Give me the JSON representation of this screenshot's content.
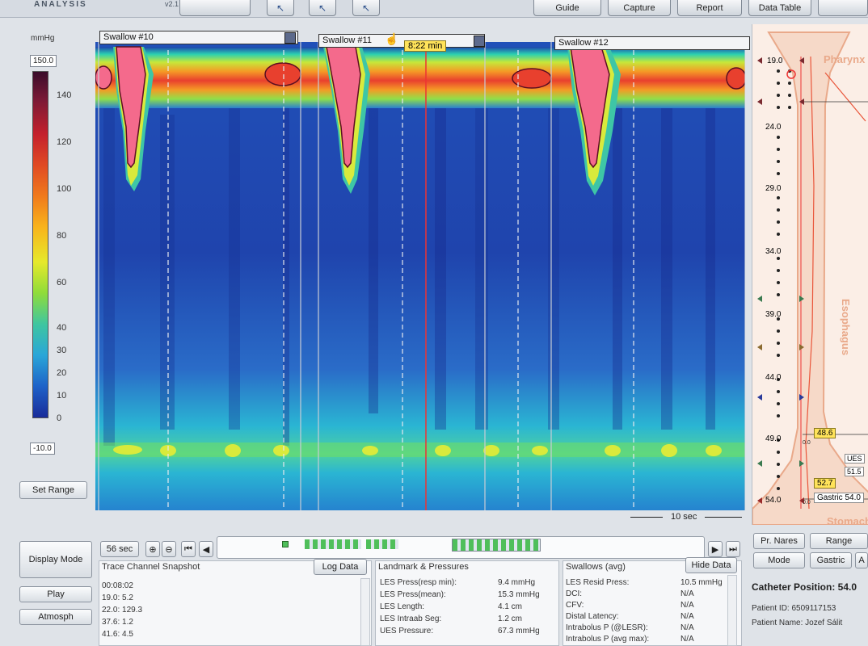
{
  "app": {
    "brand": "ANALYSIS",
    "brand_sub": "v2.1"
  },
  "toolbar": {
    "buttons": [
      {
        "label": "Guide"
      },
      {
        "label": "Capture"
      },
      {
        "label": "Report"
      },
      {
        "label": "Data Table"
      }
    ],
    "icons": [
      "arrow-back-icon",
      "zoom-region-icon",
      "cursor-arrow-icon"
    ]
  },
  "legend": {
    "unit": "mmHg",
    "max_value": "150.0",
    "min_value": "-10.0",
    "ticks": [
      "140",
      "120",
      "100",
      "80",
      "60",
      "40",
      "30",
      "20",
      "10",
      "0"
    ],
    "set_range_label": "Set Range"
  },
  "plot": {
    "swallows": [
      {
        "label": "Swallow #10"
      },
      {
        "label": "Swallow #11"
      },
      {
        "label": "Swallow #12"
      }
    ],
    "time_badge": "8:22 min",
    "scale_label": "10 sec",
    "palette": {
      "bg": "#1d3da3",
      "band": "#2ab7cf",
      "hot": "#f04a3a",
      "peak": "#f46a8c",
      "core": "#7a1230"
    }
  },
  "catheter": {
    "depths": [
      "19.0",
      "24.0",
      "29.0",
      "34.0",
      "39.0",
      "44.0",
      "49.0",
      "54.0"
    ],
    "regions": {
      "top": "Pharynx",
      "middle": "Esophagus",
      "bottom": "Stomach"
    },
    "badges": [
      "48.6",
      "52.7"
    ],
    "side_badges": [
      "UES",
      "51.5"
    ],
    "gastric_badge": "Gastric 54.0",
    "zero_labels": [
      "0.0",
      "0.0"
    ]
  },
  "navigation": {
    "duration_label": "56 sec"
  },
  "side_buttons": {
    "display_mode": "Display Mode",
    "play": "Play",
    "atmosph": "Atmosph"
  },
  "trace_snapshot": {
    "title": "Trace Channel Snapshot",
    "log_button": "Log Data",
    "rows": [
      "00:08:02",
      "19.0: 5.2",
      "22.0: 129.3",
      "37.6: 1.2",
      "41.6: 4.5"
    ]
  },
  "landmarks": {
    "title": "Landmark & Pressures",
    "rows": [
      {
        "label": "LES Press(resp min):",
        "value": "9.4 mmHg"
      },
      {
        "label": "LES Press(mean):",
        "value": "15.3 mmHg"
      },
      {
        "label": "LES Length:",
        "value": "4.1 cm"
      },
      {
        "label": "LES Intraab Seg:",
        "value": "1.2 cm"
      },
      {
        "label": "UES Pressure:",
        "value": "67.3 mmHg"
      }
    ]
  },
  "swallows_avg": {
    "title": "Swallows (avg)",
    "hide_button": "Hide Data",
    "rows": [
      {
        "label": "LES Resid Press:",
        "value": "10.5 mmHg"
      },
      {
        "label": "DCI:",
        "value": "N/A"
      },
      {
        "label": "CFV:",
        "value": "N/A"
      },
      {
        "label": "Distal Latency:",
        "value": "N/A"
      },
      {
        "label": "Intrabolus P (@LESR):",
        "value": "N/A"
      },
      {
        "label": "Intrabolus P (avg max):",
        "value": "N/A"
      }
    ]
  },
  "patient": {
    "buttons": [
      "Pr. Nares",
      "Range",
      "Mode",
      "Gastric",
      "A"
    ],
    "catheter_position": "Catheter Position: 54.0",
    "patient_id": "Patient ID: 6509117153",
    "patient_name": "Patient Name: Jozef Sálit"
  }
}
